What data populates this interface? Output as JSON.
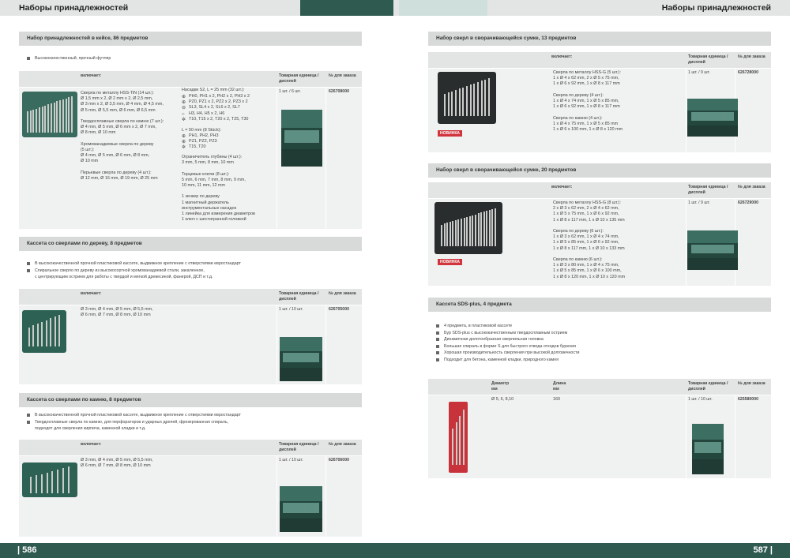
{
  "header": {
    "left_title": "Наборы принадлежностей",
    "right_title": "Наборы принадлежностей"
  },
  "footer": {
    "left_page": "| 586",
    "right_page": "587 |"
  },
  "columns": {
    "includes": "включает:",
    "unit": "Товарная единица /\nдисплей",
    "order": "№ для заказа"
  },
  "sds_columns": {
    "diameter": "Диаметр\nмм",
    "length": "Длина\nмм"
  },
  "sections": {
    "s1": {
      "title": "Набор принадлежностей в кейсе, 86 предметов",
      "bullets": [
        "Высококачественный, прочный футляр"
      ],
      "col1": "Сверла по металлу HSS-TiN (14 шт.):\nØ 1,5 mm x 2, Ø 2 mm x 2, Ø 2,5 mm,\nØ 3 mm x 2, Ø 3,5 mm, Ø 4 mm, Ø 4,5 mm,\nØ 5 mm, Ø 5,5 mm, Ø 6 mm, Ø 6,5 mm\n\nТвердосплавные сверла по камню (7 шт.):\nØ 4 mm, Ø 5 mm, Ø 6 mm x 2, Ø 7 mm,\nØ 8 mm, Ø 10 mm\n\nХромованадиевые сверла по дереву\n(5 шт.):\nØ 4 mm, Ø 5 mm, Ø 6 mm, Ø 8 mm,\nØ 10 mm\n\nПерьевые сверла по дереву (4 шт.):\nØ 12 mm, Ø 16 mm, Ø 19 mm, Ø 25 mm",
      "col2_intro": "Насадки S2, L = 25 mm (32 шт.):",
      "col2_rows": [
        "PH0, PH1 x 2, PH2 x 2, PH3 x 2",
        "PZ0, PZ1 x 2, PZ2 x 2, PZ3 x 2",
        "SL3, SL4 x 2, SL6 x 2, SL7",
        "H3, H4, H5 x 2, H6",
        "T10, T15 x 2, T20 x 2, T25, T30"
      ],
      "col2_l50": "L = 50 mm (8 Stück):",
      "col2_rows2": [
        "PH1, PH2, PH3",
        "PZ1, PZ2, PZ3",
        "T15, T20"
      ],
      "col2_rest": "Ограничитель глубины (4 шт.):\n3 mm, 5 mm, 8 mm, 10 mm\n\nТорцевые ключи (8 шт.):\n5 mm, 6 mm, 7 mm, 8 mm, 9 mm,\n10 mm, 11 mm, 12 mm\n\n1 зенкер по дереву\n1 магнитный держатель\nинструментальных насадок\n1 линейка для измерения диаметров\n1 ключ с шестигранной головкой",
      "unit": "1 шт. / 6 шт.",
      "order": "626708000"
    },
    "s2": {
      "title": "Кассета со сверлами по дереву, 8 предметов",
      "bullets": [
        "В высококачественной прочной пластиковой кассете, выдвижное крепление с отверстиями евростандарт",
        "Спиральное сверло по дереву из высокосортной хромованадиевой стали, закаленное,\nс центрирующим острием для работы с твердой и мягкой древесиной, фанерой, ДСП и т.д."
      ],
      "col1": "Ø 3 mm, Ø 4 mm, Ø 5 mm, Ø 5,5 mm,\nØ 6 mm, Ø 7 mm, Ø 8 mm, Ø 10 mm",
      "unit": "1 шт. / 10 шт.",
      "order": "626705000"
    },
    "s3": {
      "title": "Кассета со сверлами по камню, 8 предметов",
      "bullets": [
        "В высококачественной прочной пластиковой кассете, выдвижное крепление с отверстиями евростандарт",
        "Твердосплавные сверла по камню, для перфораторов и ударных дрелей, фрезерованная спираль,\nподходят для сверления кирпича, каменной кладки и т.д."
      ],
      "col1": "Ø 3 mm, Ø 4 mm, Ø 5 mm, Ø 5,5 mm,\nØ 6 mm, Ø 7 mm, Ø 8 mm, Ø 10 mm",
      "unit": "1 шт. / 10 шт.",
      "order": "626706000"
    },
    "s4": {
      "title": "Набор сверл в сворачивающейся сумке, 13 предметов",
      "col1": "Сверла по металлу HSS-G (5 шт.):\n1 x Ø 4 x 62 mm, 2 x Ø 5 x 75 mm,\n1 x Ø 6 x 92 mm, 1 x Ø 8 x 117 mm\n\nСверла по дереву (4 шт.):\n1 x Ø 4 x 74 mm, 1 x Ø 5 x 85 mm,\n1 x Ø 6 x 92 mm, 1 x Ø 8 x 117 mm\n\nСверла по камню (4 шт.):\n1 x Ø 4 x 75 mm, 1 x Ø 5 x 85 mm\n1 x Ø 6 x 100 mm, 1 x Ø 8 x 120 mm",
      "unit": "1 шт. / 9 шт.",
      "order": "626728000",
      "badge": "НОВИНКА"
    },
    "s5": {
      "title": "Набор сверл в сворачивающейся сумке, 20 предметов",
      "col1": "Сверла по металлу HSS-G (8 шт.):\n2 x Ø 3 x 62 mm, 2 x Ø 4 x 62 mm,\n1 x Ø 5 x 75 mm, 1 x Ø 6 x 92 mm,\n1 x Ø 8 x 117 mm, 1 x Ø 10 x 135 mm\n\nСверла по дереву (6 шт.):\n1 x Ø 3 x 62 mm, 1 x Ø 4 x 74 mm,\n1 x Ø 5 x 85 mm, 1 x Ø 6 x 92 mm,\n1 x Ø 8 x 117 mm, 1 x Ø 10 x 133 mm\n\nСверла по камню (6 шт.):\n1 x Ø 3 x 80 mm, 1 x Ø 4 x 75 mm,\n1 x Ø 5 x 85 mm, 1 x Ø 6 x 100 mm,\n1 x Ø 8 x 120 mm, 1 x Ø 10 x 120 mm",
      "unit": "1 шт. / 9 шт.",
      "order": "626729000",
      "badge": "НОВИНКА"
    },
    "s6": {
      "title": "Кассета SDS-plus, 4 предмета",
      "bullets": [
        "4 предмета, в пластиковой кассете",
        "Бур SDS-plus с высококачественным твердосплавным острием",
        "Динамичная долотообразная сверлильная головка",
        "Большая спираль в форме S для быстрого отвода отходов бурения",
        "Хорошая производительность сверления при высокой долговечности",
        "Подходит для бетона, каменной кладки, природного камня"
      ],
      "diameter": "Ø 5, 6, 8,10",
      "length": "160",
      "unit": "1 шт. / 10 шт.",
      "order": "625580000"
    }
  }
}
